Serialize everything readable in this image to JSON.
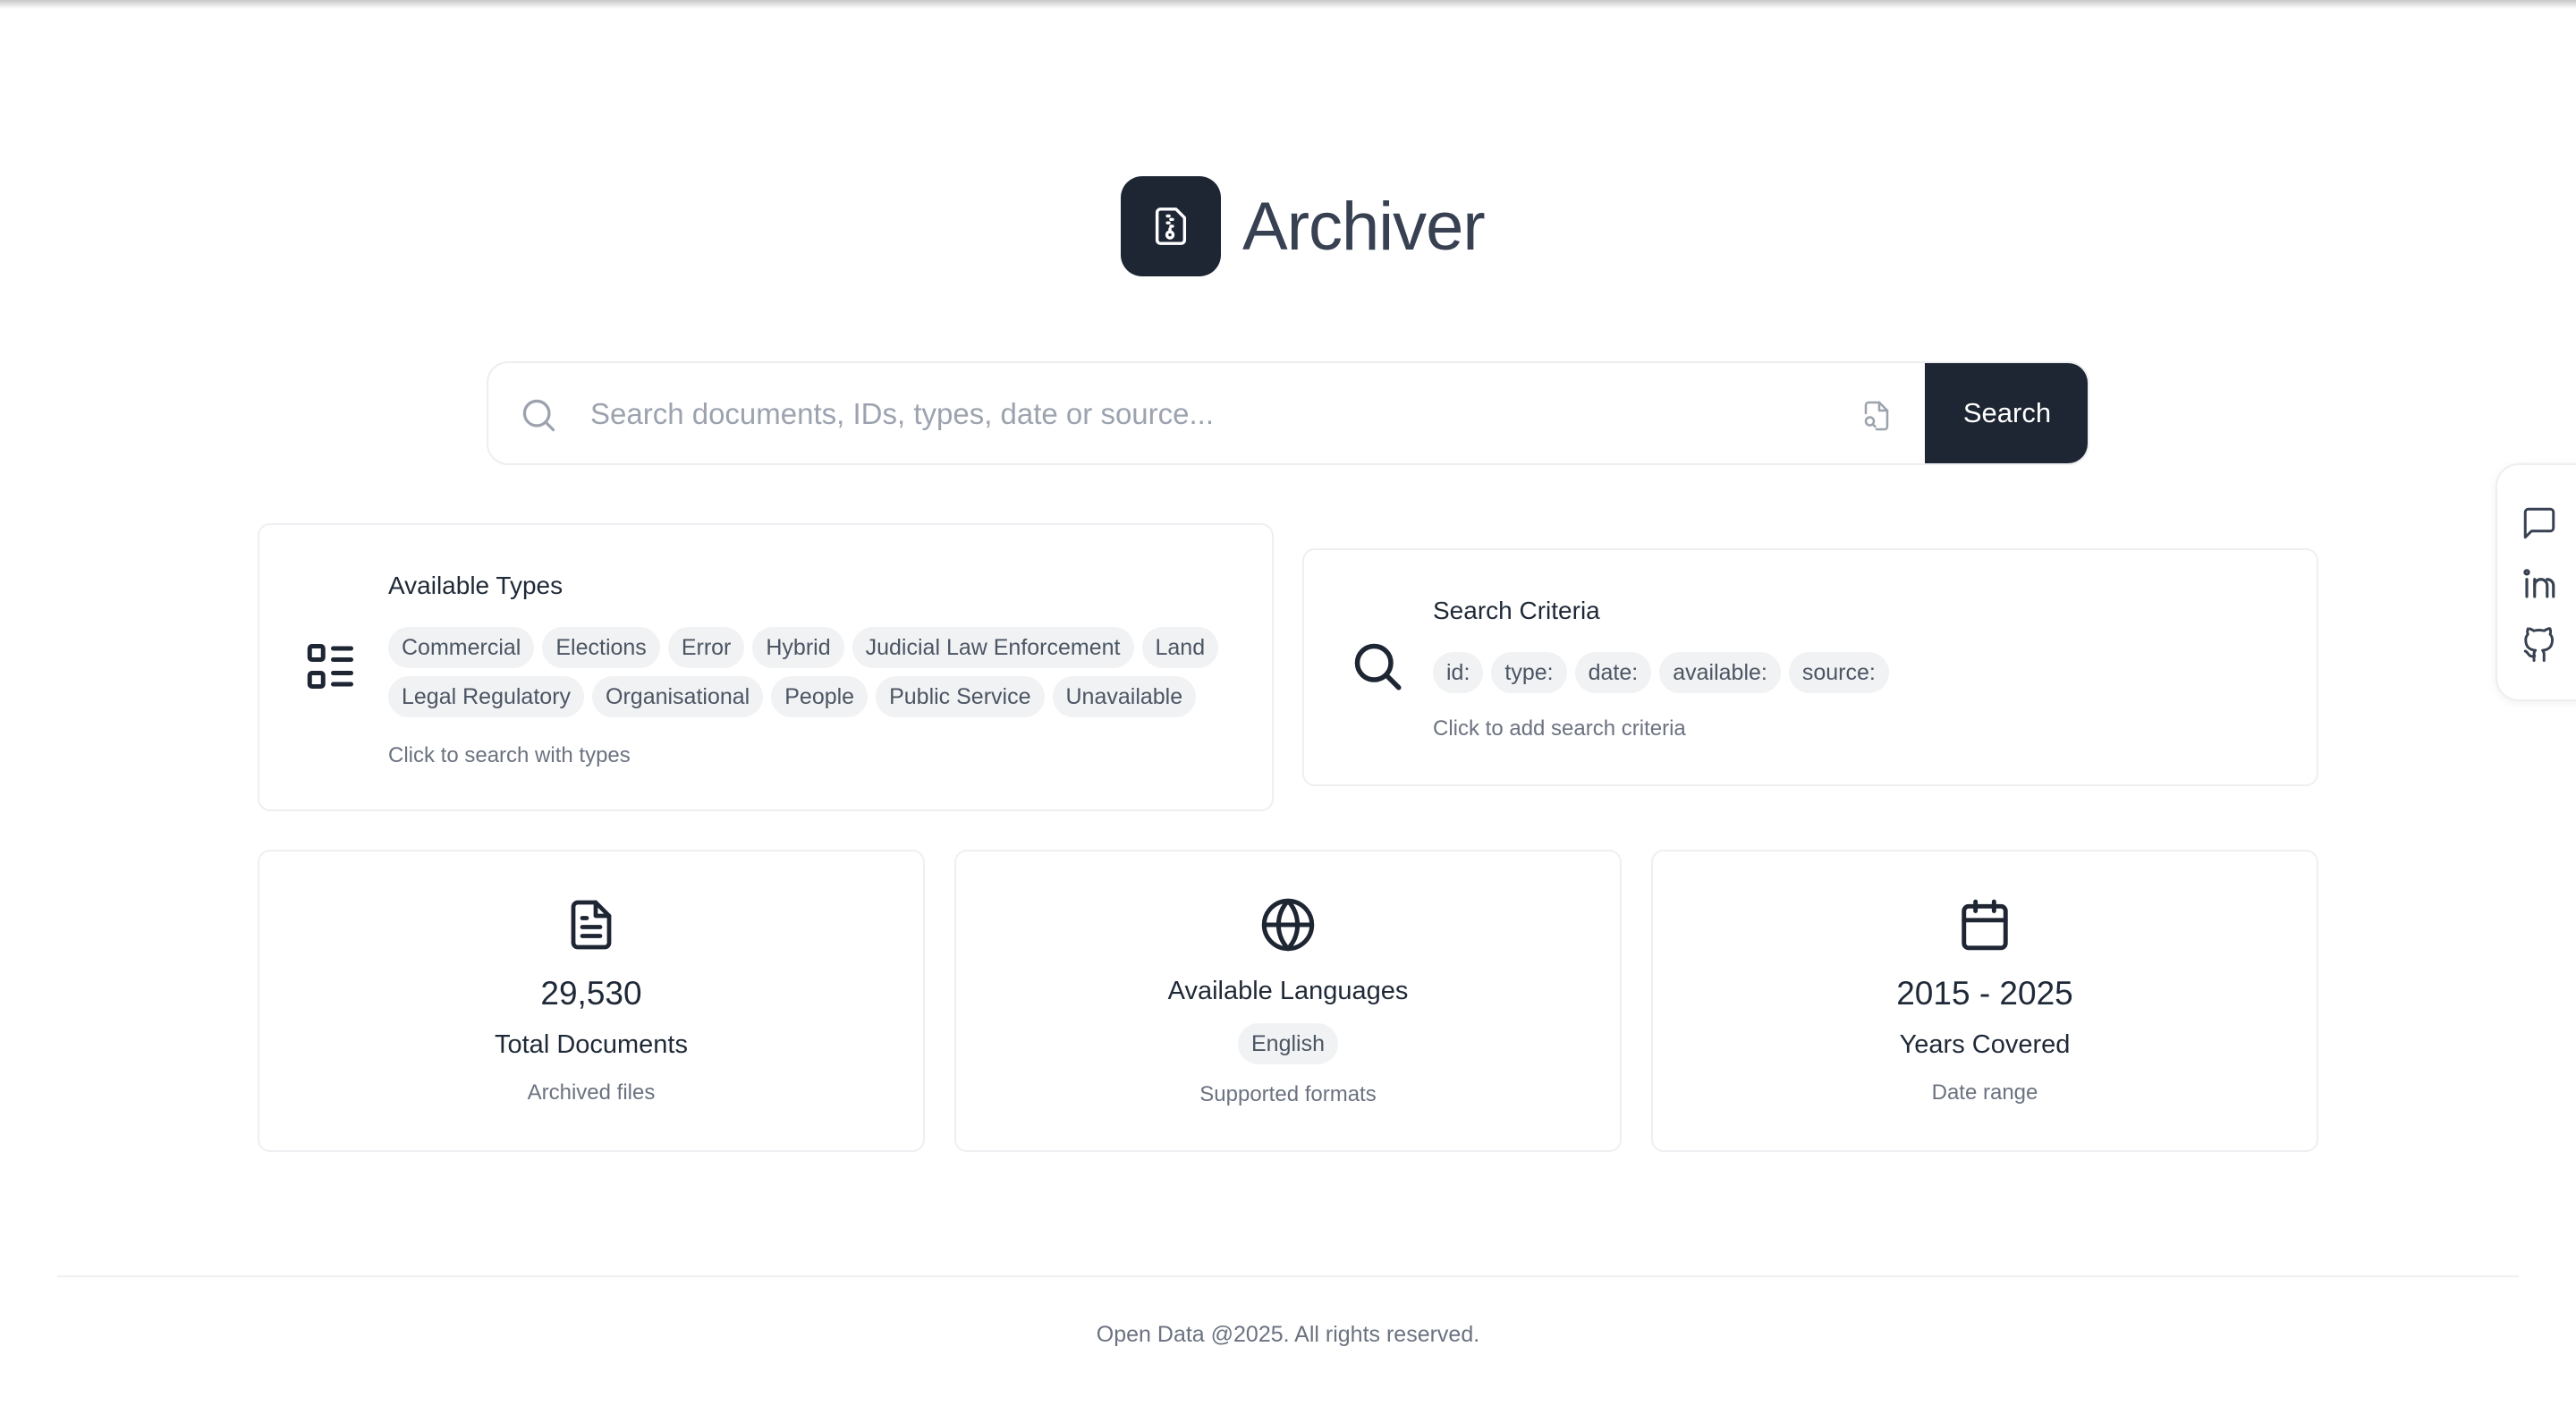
{
  "app": {
    "title": "Archiver",
    "logo_icon": "file-archive-icon"
  },
  "search": {
    "placeholder": "Search documents, IDs, types, date or source...",
    "value": "",
    "button_label": "Search",
    "leading_icon": "search-icon",
    "trailing_icon": "file-search-icon"
  },
  "types_card": {
    "title": "Available Types",
    "icon": "list-icon",
    "types": [
      "Commercial",
      "Elections",
      "Error",
      "Hybrid",
      "Judicial Law Enforcement",
      "Land",
      "Legal Regulatory",
      "Organisational",
      "People",
      "Public Service",
      "Unavailable"
    ],
    "hint": "Click to search with types"
  },
  "criteria_card": {
    "title": "Search Criteria",
    "icon": "search-icon",
    "criteria": [
      "id:",
      "type:",
      "date:",
      "available:",
      "source:"
    ],
    "hint": "Click to add search criteria"
  },
  "stats": {
    "documents": {
      "icon": "document-icon",
      "value": "29,530",
      "label": "Total Documents",
      "sub": "Archived files"
    },
    "languages": {
      "icon": "globe-icon",
      "label": "Available Languages",
      "languages": [
        "English"
      ],
      "sub": "Supported formats"
    },
    "years": {
      "icon": "calendar-icon",
      "value": "2015 - 2025",
      "label": "Years Covered",
      "sub": "Date range"
    }
  },
  "side_panel": {
    "items": [
      "chat-icon",
      "linkedin-icon",
      "github-icon"
    ]
  },
  "footer": {
    "text": "Open Data @2025. All rights reserved."
  },
  "colors": {
    "primary_dark": "#1e2533",
    "chip_bg": "#f1f2f4",
    "border": "#edeff2",
    "muted_text": "#6b7280"
  }
}
